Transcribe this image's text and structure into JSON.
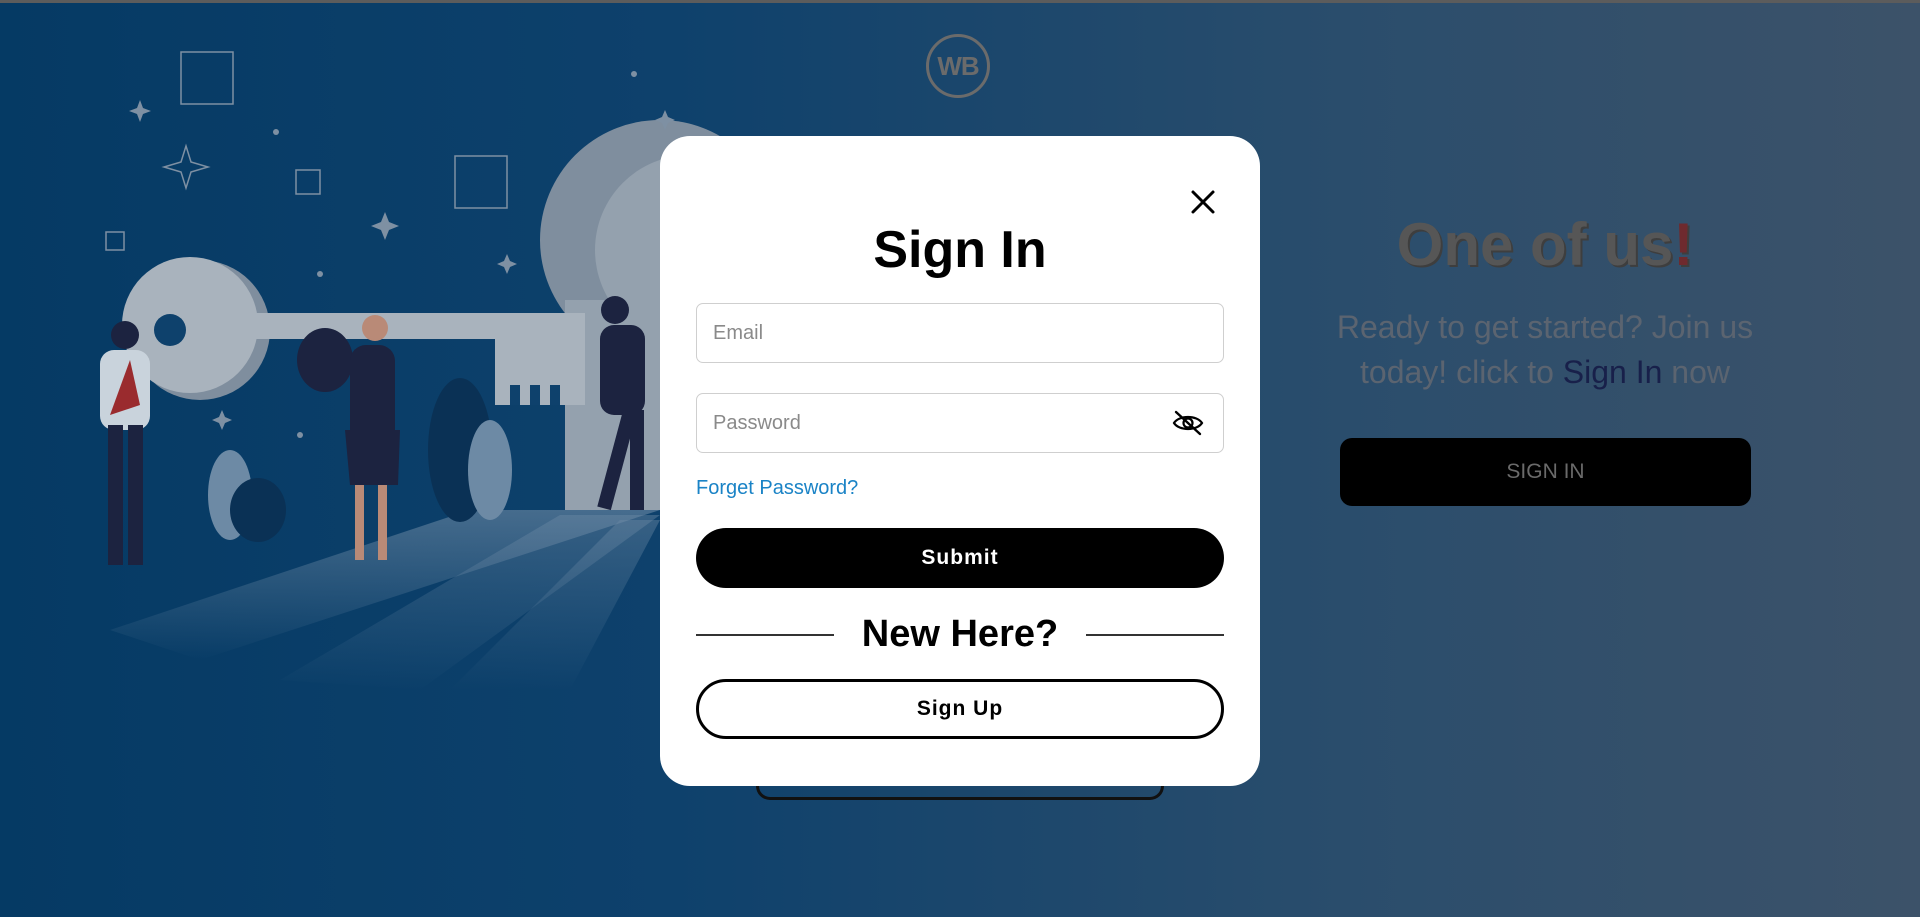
{
  "background": {
    "logo_text": "WB",
    "hero": {
      "title": "One of us",
      "title_mark": "!",
      "subtitle_before": "Ready to get started? Join us today! click to ",
      "subtitle_link": "Sign In",
      "subtitle_after": " now",
      "button_label": "SIGN IN"
    }
  },
  "modal": {
    "title": "Sign In",
    "close_icon": "close-icon",
    "email": {
      "placeholder": "Email",
      "value": ""
    },
    "password": {
      "placeholder": "Password",
      "value": "",
      "toggle_icon": "eye-slash-icon"
    },
    "forgot_label": "Forget Password?",
    "submit_label": "Submit",
    "divider_label": "New Here?",
    "signup_label": "Sign Up"
  },
  "colors": {
    "background_start": "#053a64",
    "background_end": "#3c5269",
    "link": "#1a83c6",
    "primary_button": "#000000"
  }
}
